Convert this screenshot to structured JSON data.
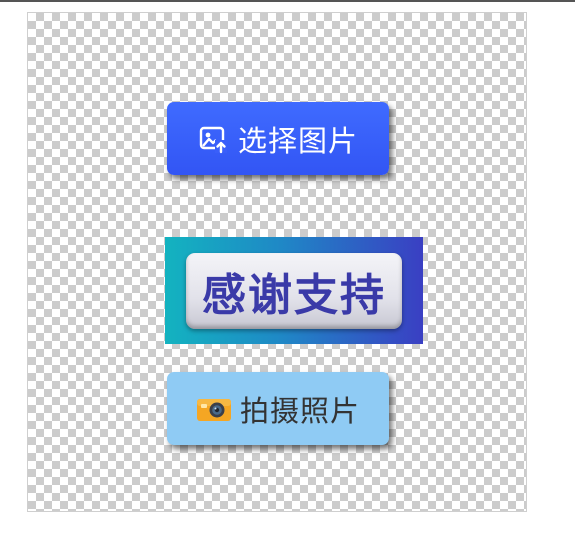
{
  "buttons": {
    "select_image": {
      "label": "选择图片",
      "icon": "image-upload-icon",
      "color": "#3a5ffa"
    },
    "thanks": {
      "label": "感谢支持",
      "color_start": "#13b3c0",
      "color_end": "#3a3fc3",
      "text_color": "#3a3aa8"
    },
    "take_photo": {
      "label": "拍摄照片",
      "icon": "camera-icon",
      "color": "#8fcbf4"
    }
  }
}
